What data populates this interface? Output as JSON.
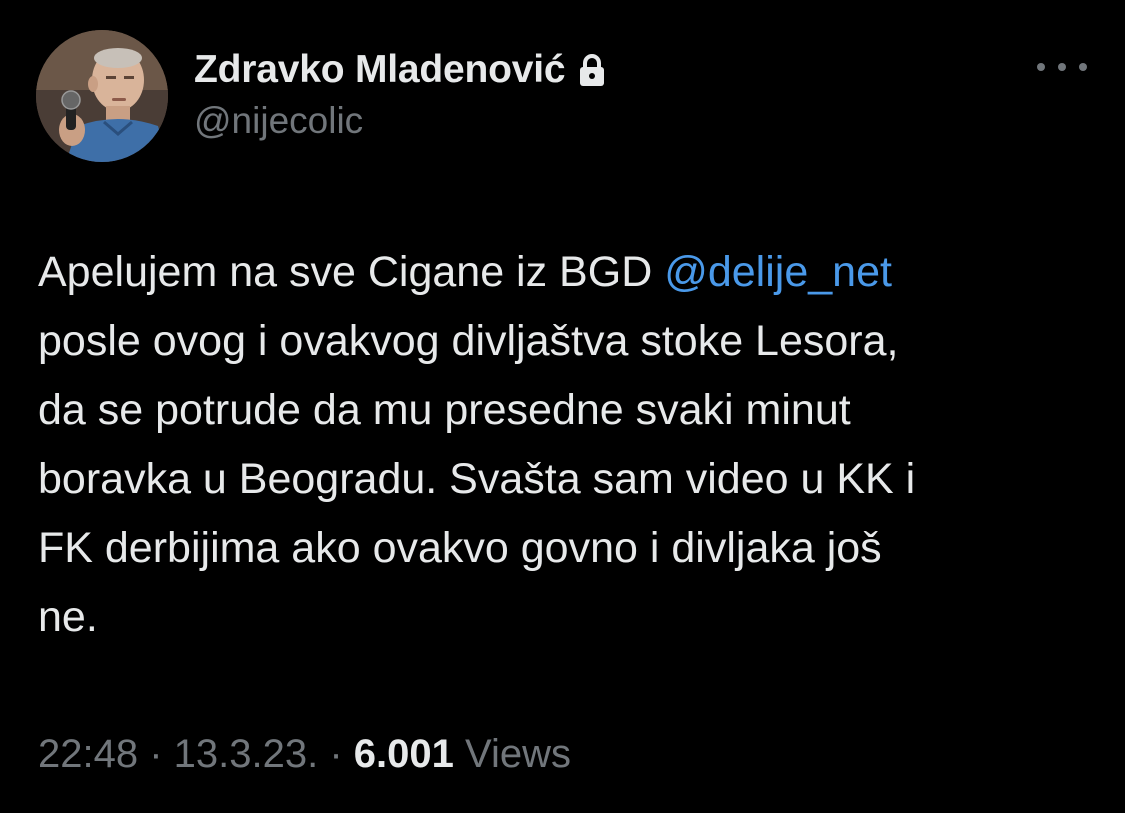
{
  "author": {
    "display_name": "Zdravko Mladenović",
    "handle": "@nijecolic",
    "protected_icon": "lock-icon"
  },
  "tweet": {
    "lines": [
      {
        "pre": "Apelujem na sve Cigane iz BGD ",
        "mention": "@delije_net"
      },
      {
        "text": "posle ovog i ovakvog divljaštva stoke Lesora,"
      },
      {
        "text": "da se potrude da mu presedne svaki minut"
      },
      {
        "text": "boravka u Beogradu. Svašta sam video u KK i"
      },
      {
        "text": "FK derbijima ako ovakvo govno i divljaka još"
      },
      {
        "text": "ne."
      }
    ]
  },
  "meta": {
    "time": "22:48",
    "separator": " · ",
    "date": "13.3.23.",
    "views_count": "6.001",
    "views_label": " Views"
  },
  "colors": {
    "background": "#000000",
    "text": "#e7e9ea",
    "secondary": "#71767b",
    "link": "#4a99e9"
  },
  "icons": {
    "more": "more-dots-icon",
    "avatar": "profile-photo"
  }
}
